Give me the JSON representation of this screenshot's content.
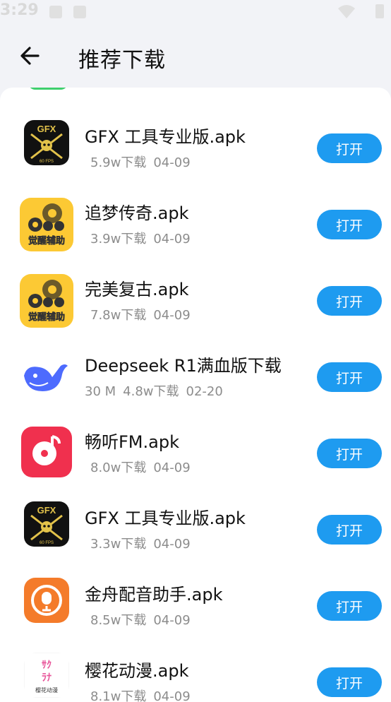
{
  "status_bar": {
    "time": "3:29"
  },
  "header": {
    "title": "推荐下载"
  },
  "apps": [
    {
      "name": "GFX 工具专业版.apk",
      "size": "",
      "downloads": "5.9w下载",
      "date": "04-09",
      "button": "打开",
      "icon": "gfx-tool-icon"
    },
    {
      "name": "追梦传奇.apk",
      "size": "",
      "downloads": "3.9w下载",
      "date": "04-09",
      "button": "打开",
      "icon": "gears-awaken-icon",
      "icon_text": "觉醒辅助"
    },
    {
      "name": "完美复古.apk",
      "size": "",
      "downloads": "7.8w下载",
      "date": "04-09",
      "button": "打开",
      "icon": "gears-awaken-icon",
      "icon_text": "觉醒辅助"
    },
    {
      "name": "Deepseek R1满血版下载",
      "size": "30 M",
      "downloads": "4.8w下载",
      "date": "02-20",
      "button": "打开",
      "icon": "whale-icon"
    },
    {
      "name": "畅听FM.apk",
      "size": "",
      "downloads": "8.0w下载",
      "date": "04-09",
      "button": "打开",
      "icon": "music-disc-icon"
    },
    {
      "name": "GFX 工具专业版.apk",
      "size": "",
      "downloads": "3.3w下载",
      "date": "04-09",
      "button": "打开",
      "icon": "gfx-tool-icon"
    },
    {
      "name": "金舟配音助手.apk",
      "size": "",
      "downloads": "8.5w下载",
      "date": "04-09",
      "button": "打开",
      "icon": "microphone-icon"
    },
    {
      "name": "樱花动漫.apk",
      "size": "",
      "downloads": "8.1w下载",
      "date": "04-09",
      "button": "打开",
      "icon": "sakura-anime-icon",
      "icon_text": "樱花动漫"
    }
  ],
  "colors": {
    "button": "#1e9bf0",
    "background": "#f2f3f7",
    "gfx_gold": "#e2c24a",
    "gears_yellow": "#fcc934",
    "whale_blue": "#4d6bfe",
    "music_red": "#f0304e",
    "mic_orange": "#f47b2a"
  }
}
